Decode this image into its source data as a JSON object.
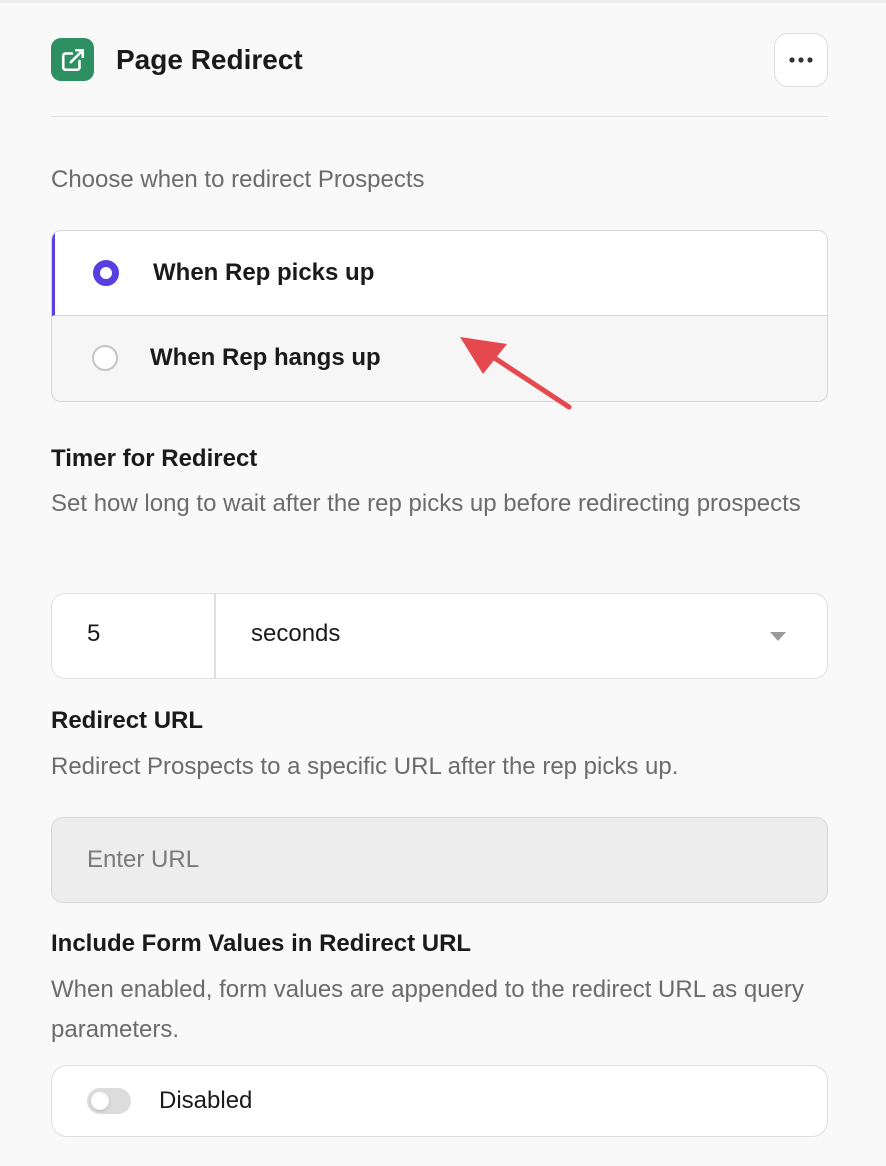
{
  "header": {
    "title": "Page Redirect",
    "app_icon": "external-link-icon",
    "more_icon": "more-horizontal-icon",
    "brand_color": "#2e8f63"
  },
  "redirect_when": {
    "prompt": "Choose when to redirect Prospects",
    "options": [
      {
        "label": "When Rep picks up",
        "selected": true
      },
      {
        "label": "When Rep hangs up",
        "selected": false
      }
    ],
    "accent_color": "#5a3fe0"
  },
  "timer": {
    "heading": "Timer for Redirect",
    "description": "Set how long to wait after the rep picks up before redirecting prospects",
    "value": "5",
    "unit": "seconds"
  },
  "redirect_url": {
    "heading": "Redirect URL",
    "description": "Redirect Prospects to a specific URL after the rep picks up.",
    "placeholder": "Enter URL",
    "value": ""
  },
  "form_values": {
    "heading": "Include Form Values in Redirect URL",
    "description": "When enabled, form values are appended to the redirect URL as query parameters.",
    "toggle_state": "Disabled",
    "enabled": false
  },
  "annotation": {
    "arrow_color": "#e5484d"
  }
}
